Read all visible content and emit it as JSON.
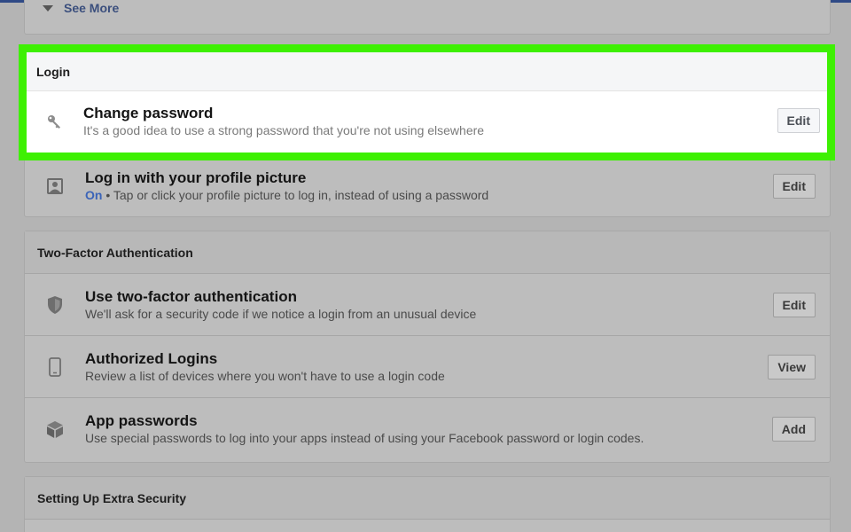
{
  "see_more": {
    "label": "See More"
  },
  "login": {
    "header": "Login",
    "change_password": {
      "title": "Change password",
      "description": "It's a good idea to use a strong password that you're not using elsewhere",
      "button": "Edit",
      "icon": "key-icon"
    },
    "profile_picture": {
      "title": "Log in with your profile picture",
      "status": "On",
      "description": " • Tap or click your profile picture to log in, instead of using a password",
      "button": "Edit",
      "icon": "profile-picture-icon"
    }
  },
  "two_factor": {
    "header": "Two-Factor Authentication",
    "items": [
      {
        "title": "Use two-factor authentication",
        "description": "We'll ask for a security code if we notice a login from an unusual device",
        "button": "Edit",
        "icon": "shield-icon"
      },
      {
        "title": "Authorized Logins",
        "description": "Review a list of devices where you won't have to use a login code",
        "button": "View",
        "icon": "phone-icon"
      },
      {
        "title": "App passwords",
        "description": "Use special passwords to log into your apps instead of using your Facebook password or login codes.",
        "button": "Add",
        "icon": "cube-icon"
      }
    ]
  },
  "extra_security": {
    "header": "Setting Up Extra Security"
  },
  "colors": {
    "highlight": "#3ef003",
    "link_blue": "#3b64b8",
    "dimmed_background": "#b4b4b4"
  }
}
